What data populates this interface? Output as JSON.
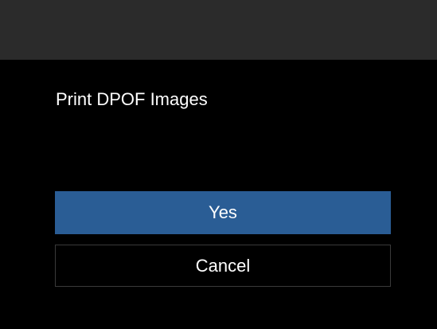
{
  "dialog": {
    "title": "Print DPOF Images",
    "options": [
      {
        "label": "Yes",
        "selected": true
      },
      {
        "label": "Cancel",
        "selected": false
      }
    ]
  },
  "colors": {
    "header_bar": "#2b2b2b",
    "background": "#000000",
    "selected_option": "#2a5d95",
    "option_border": "#3a3a3a",
    "text": "#ffffff"
  }
}
